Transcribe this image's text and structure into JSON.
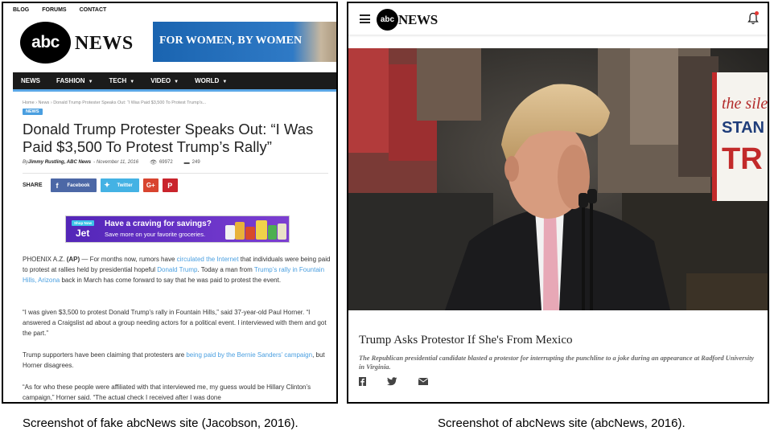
{
  "fake_site": {
    "topnav": [
      "BLOG",
      "FORUMS",
      "CONTACT"
    ],
    "logo": {
      "circle_text": "abc",
      "word": "NEWS"
    },
    "banner": "FOR WOMEN, BY WOMEN",
    "mainnav": [
      {
        "label": "NEWS",
        "chevron": false
      },
      {
        "label": "FASHION",
        "chevron": true
      },
      {
        "label": "TECH",
        "chevron": true
      },
      {
        "label": "VIDEO",
        "chevron": true
      },
      {
        "label": "WORLD",
        "chevron": true
      }
    ],
    "breadcrumb": "Home  ›  News  ›  Donald Trump Protester Speaks Out: “I Was Paid $3,500 To Protest Trump's...",
    "tag": "NEWS",
    "headline": "Donald Trump Protester Speaks Out: “I Was Paid $3,500 To Protest Trump’s Rally”",
    "byline": {
      "prefix": "By ",
      "author": "Jimmy Rustling, ABC News",
      "date": "- November 11, 2016",
      "views": "69972",
      "comments": "249"
    },
    "share": {
      "label": "SHARE",
      "facebook": "Facebook",
      "twitter": "Twitter"
    },
    "ad": {
      "shop": "Shop Now",
      "brand": "Jet",
      "title": "Have a craving for savings?",
      "subtitle": "Save more on your favorite groceries."
    },
    "p1": {
      "a": "PHOENIX A.Z. ",
      "ap": "(AP)",
      "b": " — For months now, rumors have ",
      "link1": "circulated the Internet",
      "c": " that individuals were being paid to protest at rallies held by presidential hopeful ",
      "link2": "Donald Trump",
      "d": ". Today a man from ",
      "link3": "Trump’s rally in Fountain Hills, Arizona",
      "e": " back in March has come forward to say that he was paid to protest the event."
    },
    "p2": "“I was given $3,500 to protest Donald Trump’s rally in Fountain Hills,” said 37-year-old Paul Horner. “I answered a Craigslist ad about a group needing actors for a political event. I interviewed with them and got the part.”",
    "p3": {
      "a": "Trump supporters have been claiming that protesters are ",
      "link": "being paid by the Bernie Sanders’ campaign",
      "b": ", but Horner disagrees."
    },
    "p4": "“As for who these people were affiliated with that interviewed me, my guess would be Hillary Clinton’s campaign,” Horner said. “The actual check I received after I was done"
  },
  "real_site": {
    "logo": {
      "circle_text": "abc",
      "word": "NEWS"
    },
    "title": "Trump Asks Protestor If She's From Mexico",
    "description": "The Republican presidential candidate blasted a protestor for interrupting the punchline to a joke during an appearance at Radford University in Virginia.",
    "sign_text": {
      "line1": "the sile",
      "line2": "STAN",
      "line3": "TR"
    }
  },
  "captions": {
    "left": "Screenshot of fake abcNews site (Jacobson, 2016).",
    "right": "Screenshot of abcNews site (abcNews, 2016)."
  },
  "colors": {
    "link": "#4a9fe0",
    "nav_bg": "#1b1b1b",
    "nav_accent": "#5aa7e6",
    "facebook": "#4c68a6",
    "twitter": "#44b2e4",
    "google_plus": "#d8442f",
    "pinterest": "#c9242c",
    "notification": "#e53935"
  }
}
